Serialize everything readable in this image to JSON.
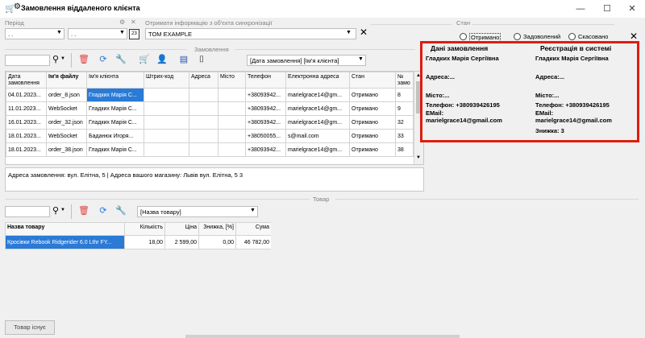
{
  "window": {
    "title": "Замовлення віддаленого клієнта",
    "minimize_glyph": "—",
    "maximize_glyph": "☐",
    "close_glyph": "✕"
  },
  "period": {
    "label": "Період",
    "date_from": " .  .",
    "date_to": " .  .",
    "calendar_glyph": "23"
  },
  "sync": {
    "label": "Отримати інформацію з об'єкта синхронізації",
    "value": "TOM EXAMPLE"
  },
  "state_filter": {
    "label": "Стан",
    "options": [
      "Отримано",
      "Задоволений",
      "Скасовано"
    ],
    "selected": "Отримано"
  },
  "orders": {
    "section_label": "Замовлення",
    "sort_value": "[Дата замовлення]  [Ім'я клієнта]",
    "columns": [
      "Дата замовлення",
      "Ім'я файлу",
      "Ім'я клієнта",
      "Штрих-код",
      "Адреса",
      "Місто",
      "Телефон",
      "Електронна адреса",
      "Стан",
      "№ замо"
    ],
    "rows": [
      [
        "04.01.2023...",
        "order_8.json",
        "Гладких Марія С...",
        "",
        "",
        "",
        "+38093942...",
        "marielgrace14@gm...",
        "Отримано",
        "8"
      ],
      [
        "11.01.2023...",
        "WebSocket",
        "Гладких Марія С...",
        "",
        "",
        "",
        "+38093942...",
        "marielgrace14@gm...",
        "Отримано",
        "9"
      ],
      [
        "16.01.2023...",
        "order_32.json",
        "Гладких Марія С...",
        "",
        "",
        "",
        "+38093942...",
        "marielgrace14@gm...",
        "Отримано",
        "32"
      ],
      [
        "18.01.2023...",
        "WebSocket",
        "Баданюк Игоря...",
        "",
        "",
        "",
        "+38050055...",
        "s@mail.com",
        "Отримано",
        "33"
      ],
      [
        "18.01.2023...",
        "order_38.json",
        "Гладких Марія С...",
        "",
        "",
        "",
        "+38093942...",
        "marielgrace14@gm...",
        "Отримано",
        "38"
      ]
    ],
    "selected_row": 0,
    "address_note": "Адреса замовлення: вул. Елітна, 5 | Адреса вашого магазину: Львів вул. Елітна, 5 3"
  },
  "details": {
    "order_header": "Дані замовлення",
    "order_name": "Гладких Марія Сергіївна",
    "order_address": "Адреса:...",
    "order_city": "Місто:...",
    "order_phone": "Телефон: +380939426195",
    "order_email_label": "EMail:",
    "order_email": "marielgrace14@gmail.com",
    "reg_header": "Реєстрація в системі",
    "reg_name": "Гладких Марія Сергіївна",
    "reg_address": "Адреса:...",
    "reg_city": "Місто:...",
    "reg_phone": "Телефон: +380939426195",
    "reg_email_label": "EMail:",
    "reg_email": "marielgrace14@gmail.com",
    "reg_discount": "Знижка: 3"
  },
  "goods": {
    "section_label": "Товар",
    "sort_value": "[Назва товару]",
    "columns": [
      "Назва товару",
      "Кількість",
      "Ціна",
      "Знижка, [%]",
      "Сума"
    ],
    "rows": [
      [
        "Кросівки Rebook Ridgerider 6.0 Lthr FY...",
        "18,00",
        "2 599,00",
        "0,00",
        "46 782,00"
      ]
    ],
    "status_button": "Товар існує"
  },
  "colors": {
    "accent": "#2a7ad6",
    "highlight_border": "#e01c10",
    "delete_icon": "#e04040"
  }
}
